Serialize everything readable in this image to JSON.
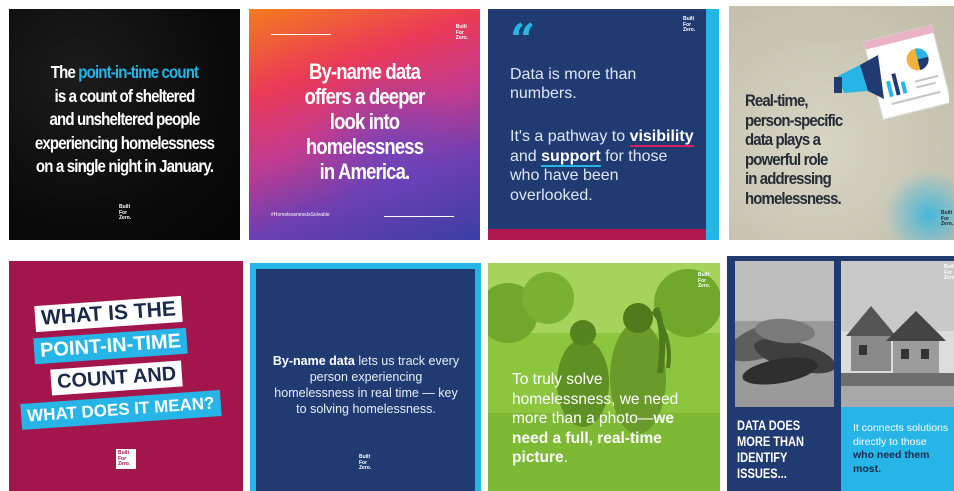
{
  "brand": {
    "logo_lines": [
      "Built",
      "For",
      "Zero."
    ]
  },
  "tile1": {
    "pre": "The ",
    "highlight": "point-in-time count",
    "rest_lines": [
      "is a count of sheltered",
      "and unsheltered people",
      "experiencing homelessness",
      "on a single night in January."
    ],
    "highlight_color": "#27b4e6"
  },
  "tile2": {
    "lines": [
      "By-name data",
      "offers a deeper",
      "look into",
      "homelessness",
      "in America."
    ],
    "hashtag": "#HomelessnessIsSolvable"
  },
  "tile3": {
    "quote_mark": "“",
    "p1": "Data is more than numbers.",
    "p2_pre": "It's a pathway to ",
    "p2_em1": "visibility",
    "p2_mid": " and ",
    "p2_em2": "support",
    "p2_post": " for those who have been overlooked."
  },
  "tile4": {
    "lines": [
      "Real-time,",
      "person-specific",
      "data plays a",
      "powerful role",
      "in addressing",
      "homelessness."
    ],
    "icon": "megaphone-chart-icon"
  },
  "tile5": {
    "lines": [
      "WHAT IS THE",
      "POINT-IN-TIME",
      "COUNT AND",
      "WHAT DOES IT MEAN?"
    ]
  },
  "tile6": {
    "bold": "By-name data",
    "rest": " lets us track every person experiencing homelessness in real time — key to solving homelessness."
  },
  "tile7": {
    "pre": "To truly solve homelessness, we need more than a photo—",
    "bold": "we need a full, real-time picture",
    "post": "."
  },
  "tile8": {
    "heading_lines": [
      "DATA DOES",
      "MORE THAN",
      "IDENTIFY",
      "ISSUES..."
    ],
    "p_pre": "It connects solutions directly to those ",
    "p_bold": "who need them most."
  },
  "colors": {
    "navy": "#1f3b72",
    "cyan": "#27b4e6",
    "magenta": "#a2164c",
    "green": "#8cc63f"
  }
}
